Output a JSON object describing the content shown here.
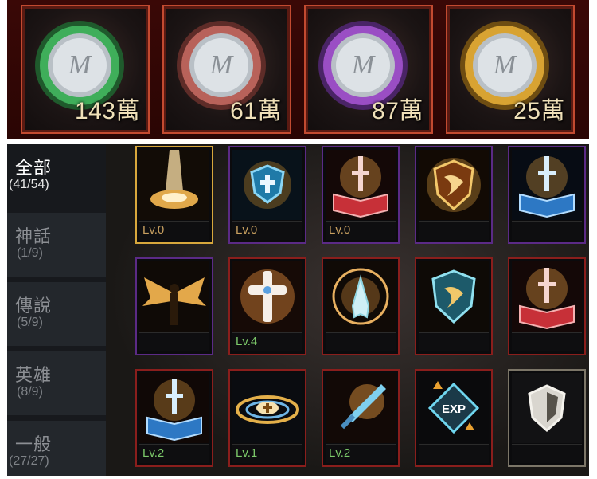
{
  "currencies": [
    {
      "amount": "143萬",
      "icon": "green-ring-coin-icon",
      "ring_color": "#3fae5a"
    },
    {
      "amount": "61萬",
      "icon": "copper-ring-coin-icon",
      "ring_color": "#b8625a"
    },
    {
      "amount": "87萬",
      "icon": "purple-ring-coin-icon",
      "ring_color": "#9a4ec4"
    },
    {
      "amount": "25萬",
      "icon": "gold-ring-coin-icon",
      "ring_color": "#d8a332"
    }
  ],
  "tabs": [
    {
      "name": "全部",
      "count": "(41/54)",
      "active": true
    },
    {
      "name": "神話",
      "count": "(1/9)",
      "active": false
    },
    {
      "name": "傳說",
      "count": "(5/9)",
      "active": false
    },
    {
      "name": "英雄",
      "count": "(8/9)",
      "active": false
    },
    {
      "name": "一般",
      "count": "(27/27)",
      "active": false
    }
  ],
  "cards": [
    {
      "icon": "light-burst-icon",
      "level": "Lv.0",
      "frame": "gold"
    },
    {
      "icon": "blue-cross-shield-icon",
      "level": "Lv.0",
      "frame": "purple"
    },
    {
      "icon": "red-sword-book-icon",
      "level": "Lv.0",
      "frame": "purple"
    },
    {
      "icon": "gold-crest-shield-icon",
      "level": "",
      "frame": "purple"
    },
    {
      "icon": "blue-sword-book-icon",
      "level": "",
      "frame": "purple"
    },
    {
      "icon": "winged-figure-icon",
      "level": "",
      "frame": "purple"
    },
    {
      "icon": "radiant-cross-icon",
      "level": "Lv.4",
      "frame": "red"
    },
    {
      "icon": "praying-hands-icon",
      "level": "",
      "frame": "red"
    },
    {
      "icon": "blue-crest-shield-icon",
      "level": "",
      "frame": "red"
    },
    {
      "icon": "red-sword-book-icon-2",
      "level": "",
      "frame": "red"
    },
    {
      "icon": "blue-sword-book-icon-2",
      "level": "Lv.2",
      "frame": "red"
    },
    {
      "icon": "cross-vortex-icon",
      "level": "Lv.1",
      "frame": "red"
    },
    {
      "icon": "glowing-sword-icon",
      "level": "Lv.2",
      "frame": "red"
    },
    {
      "icon": "exp-badge-icon",
      "level": "",
      "frame": "red"
    },
    {
      "icon": "white-shield-icon",
      "level": "",
      "frame": "gray"
    }
  ]
}
